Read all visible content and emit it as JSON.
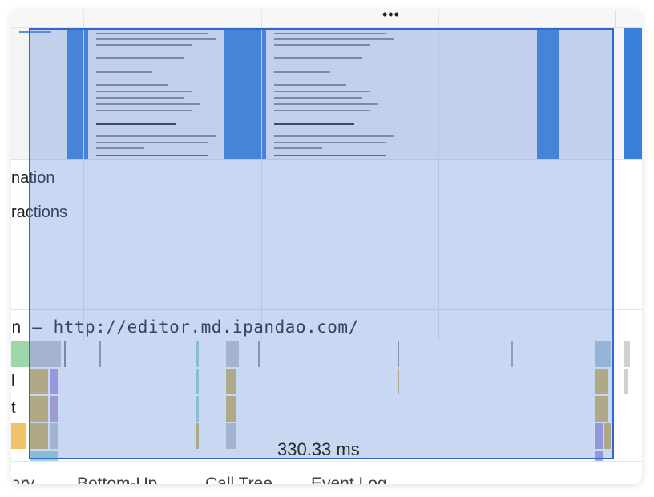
{
  "toolbar": {
    "more_label": "•••"
  },
  "tracks": {
    "animation": "nation",
    "interactions": "ractions",
    "main_url": "n — http://editor.md.ipandao.com/"
  },
  "flame_labels": [
    "l",
    "t"
  ],
  "selection": {
    "duration": "330.33 ms"
  },
  "tabs": [
    {
      "label": "ary"
    },
    {
      "label": "Bottom-Up"
    },
    {
      "label": "Call Tree"
    },
    {
      "label": "Event Log"
    }
  ],
  "colors": {
    "selection": "#5f8cdc",
    "selection_border": "#3467c9",
    "screenshot_blue": "#3a7fd8",
    "scripting": "#f0c36b",
    "rendering": "#b39ddb",
    "painting": "#7fc8a9"
  }
}
